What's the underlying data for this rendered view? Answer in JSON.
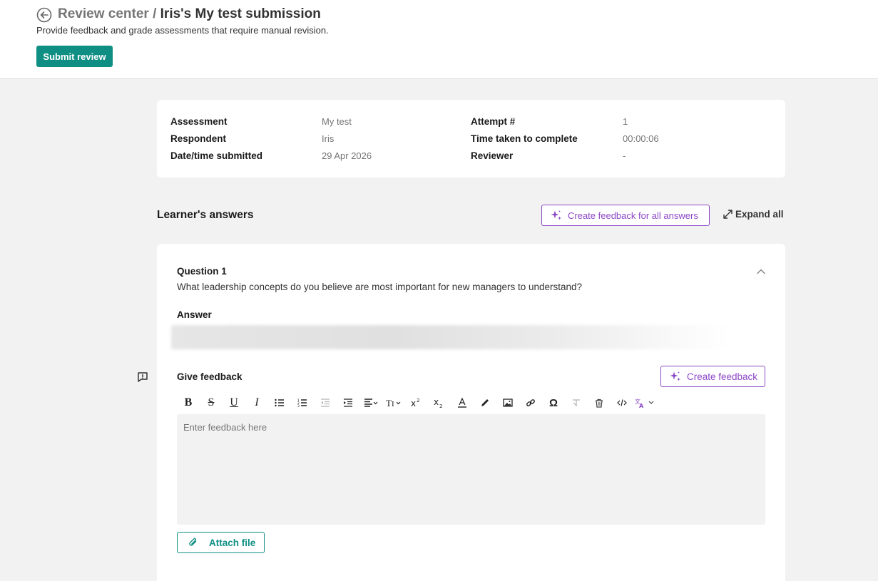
{
  "header": {
    "breadcrumb_root": "Review center",
    "breadcrumb_separator": " / ",
    "page_title": "Iris's My test submission",
    "subtitle": "Provide feedback and grade assessments that require manual revision.",
    "submit_label": "Submit review"
  },
  "info": {
    "assessment_label": "Assessment",
    "assessment_value": "My test",
    "respondent_label": "Respondent",
    "respondent_value": "Iris",
    "date_label": "Date/time submitted",
    "date_value": "29 Apr 2026",
    "attempt_label": "Attempt #",
    "attempt_value": "1",
    "time_label": "Time taken to complete",
    "time_value": "00:00:06",
    "reviewer_label": "Reviewer",
    "reviewer_value": "-"
  },
  "answers": {
    "section_title": "Learner's answers",
    "create_all_label": "Create feedback for all answers",
    "expand_all_label": "Expand all"
  },
  "question": {
    "title": "Question 1",
    "text": "What leadership concepts do you believe are most important for new managers to understand?",
    "answer_label": "Answer",
    "feedback_label": "Give feedback",
    "create_feedback_label": "Create feedback",
    "editor_placeholder": "Enter feedback here",
    "attach_label": "Attach file"
  },
  "toolbar": {
    "items": [
      "bold",
      "strikethrough",
      "underline",
      "italic",
      "bulleted-list",
      "numbered-list",
      "outdent",
      "indent",
      "align",
      "font-size",
      "superscript",
      "subscript",
      "font-color",
      "highlight",
      "image",
      "link",
      "special-character",
      "clear-format",
      "delete",
      "code",
      "translate"
    ]
  },
  "colors": {
    "primary": "#0f8f84",
    "ai_accent": "#8c48c7",
    "background": "#f2f2f2"
  }
}
